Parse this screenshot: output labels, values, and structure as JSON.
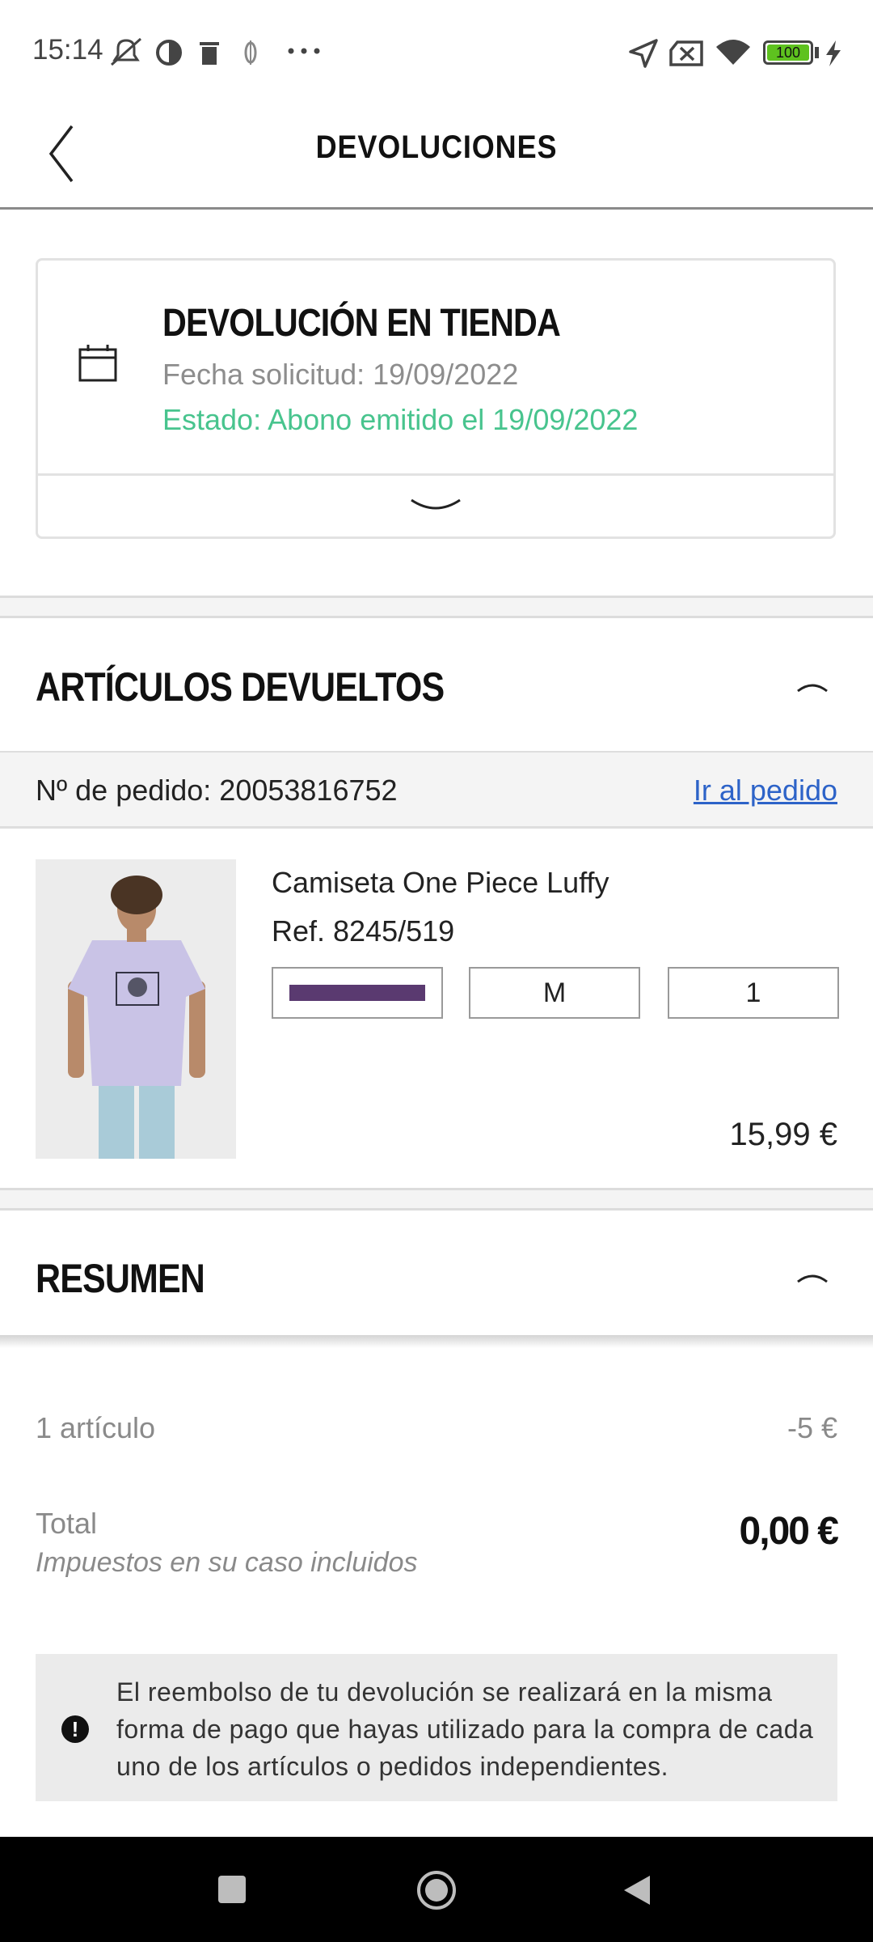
{
  "status_bar": {
    "time": "15:14",
    "battery": "100",
    "icons": [
      "muted-bell-icon",
      "contrast-icon",
      "trash-icon",
      "vpn-key-icon",
      "more-dots-icon",
      "location-arrow-icon",
      "sim-x-icon",
      "wifi-icon",
      "battery-icon",
      "charging-bolt-icon"
    ]
  },
  "header": {
    "title": "DEVOLUCIONES"
  },
  "return_card": {
    "title": "DEVOLUCIÓN EN TIENDA",
    "date_line": "Fecha solicitud: 19/09/2022",
    "status_line": "Estado: Abono emitido el 19/09/2022",
    "status_color": "#48c48e"
  },
  "returned_items": {
    "title": "ARTÍCULOS DEVUELTOS",
    "order_label": "Nº de pedido: 20053816752",
    "order_link": "Ir al pedido",
    "product": {
      "name": "Camiseta One Piece Luffy",
      "ref": "Ref. 8245/519",
      "color_swatch": "#5a3a70",
      "size": "M",
      "quantity": "1",
      "price": "15,99 €"
    }
  },
  "summary": {
    "title": "RESUMEN",
    "items_label": "1 artículo",
    "items_value": "-5 €",
    "total_label": "Total",
    "total_value": "0,00 €",
    "tax_note": "Impuestos en su caso incluidos",
    "info_text": "El reembolso de tu devolución se realizará en la misma forma de pago que hayas utilizado para la compra de cada uno de los artículos o pedidos independientes."
  }
}
